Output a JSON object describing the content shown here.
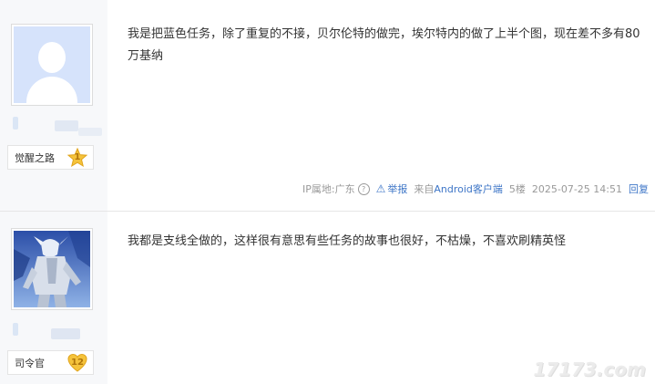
{
  "posts": [
    {
      "badge_title": "觉醒之路",
      "level": "1",
      "content": "我是把蓝色任务，除了重复的不接，贝尔伦特的做完，埃尔特内的做了上半个图，现在差不多有80万基纳",
      "meta": {
        "ip_label": "IP属地:广东",
        "report_label": "举报",
        "from_label": "来自",
        "client_label": "Android客户端",
        "floor": "5楼",
        "time": "2025-07-25 14:51",
        "reply_label": "回复"
      }
    },
    {
      "badge_title": "司令官",
      "level": "12",
      "content": "我都是支线全做的，这样很有意思有些任务的故事也很好，不枯燥，不喜欢刷精英怪"
    }
  ],
  "watermark": "17173.com",
  "colors": {
    "link": "#3e76c7",
    "sidebar_bg": "#f7f8fa",
    "avatar_default_bg": "#d6e3fb",
    "level_badge": "#f5c33b"
  },
  "icons": [
    "default-avatar-icon",
    "level-star-icon",
    "level-heart-icon",
    "help-circle-icon",
    "warning-triangle-icon"
  ]
}
